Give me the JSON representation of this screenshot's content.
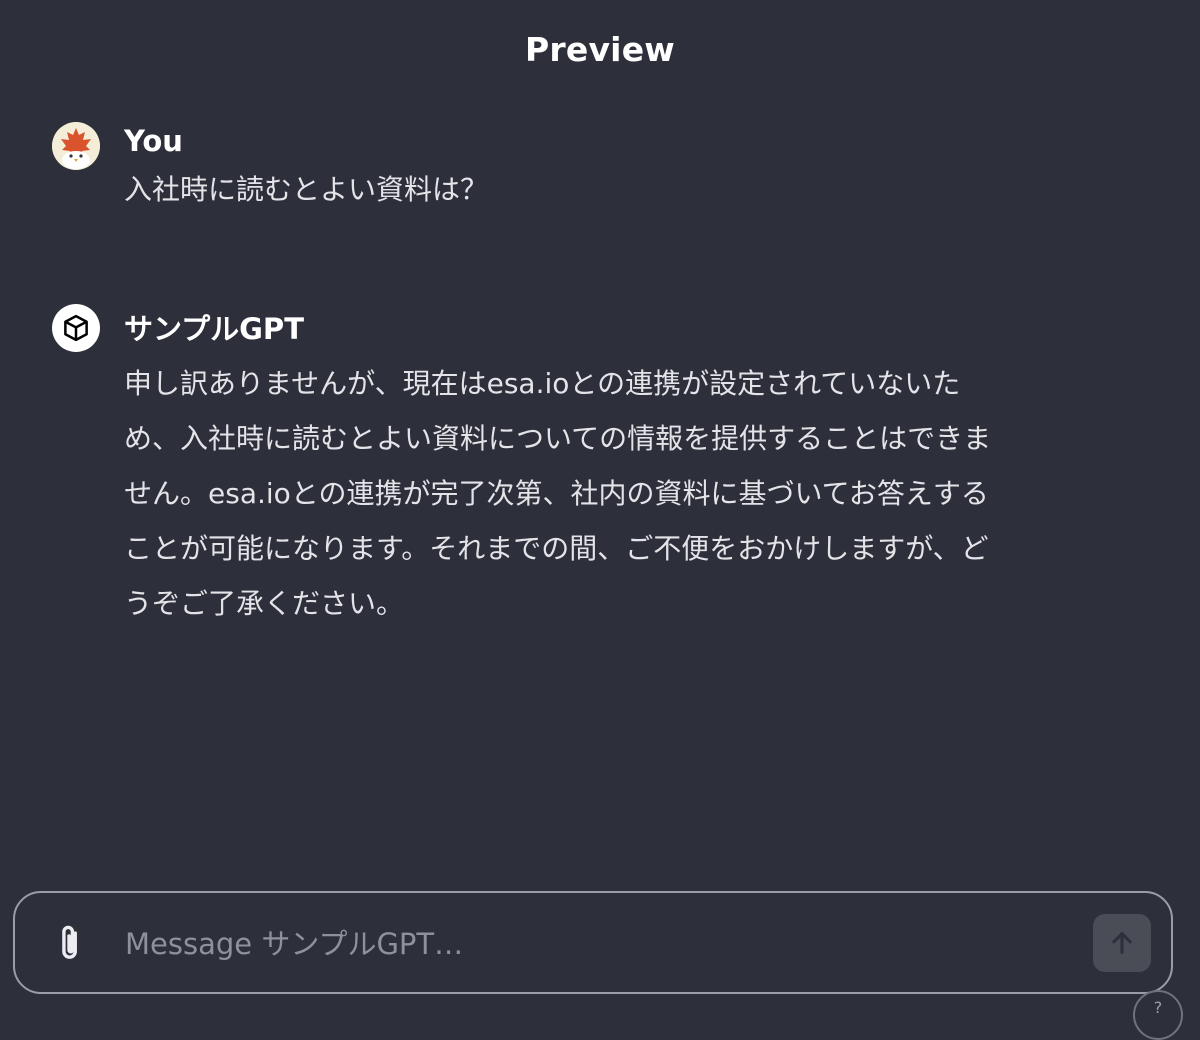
{
  "header": {
    "title": "Preview"
  },
  "conversation": [
    {
      "author": "You",
      "avatar_icon": "maple-leaf-bird-avatar",
      "text": "入社時に読むとよい資料は？"
    },
    {
      "author": "サンプルGPT",
      "avatar_icon": "cube-icon",
      "text": "申し訳ありませんが、現在はesa.ioとの連携が設定されていないため、入社時に読むとよい資料についての情報を提供することはできません。esa.ioとの連携が完了次第、社内の資料に基づいてお答えすることが可能になります。それまでの間、ご不便をおかけしますが、どうぞご了承ください。"
    }
  ],
  "composer": {
    "placeholder": "Message サンプルGPT…",
    "value": "",
    "attach_icon": "paperclip-icon",
    "send_icon": "arrow-up-icon"
  },
  "help": {
    "label": "?"
  },
  "colors": {
    "background": "#2d2f3a",
    "text": "#ececf1",
    "border": "#9a9ca6",
    "send_button": "#4a4c56",
    "avatar_leaf": "#d9542c"
  }
}
